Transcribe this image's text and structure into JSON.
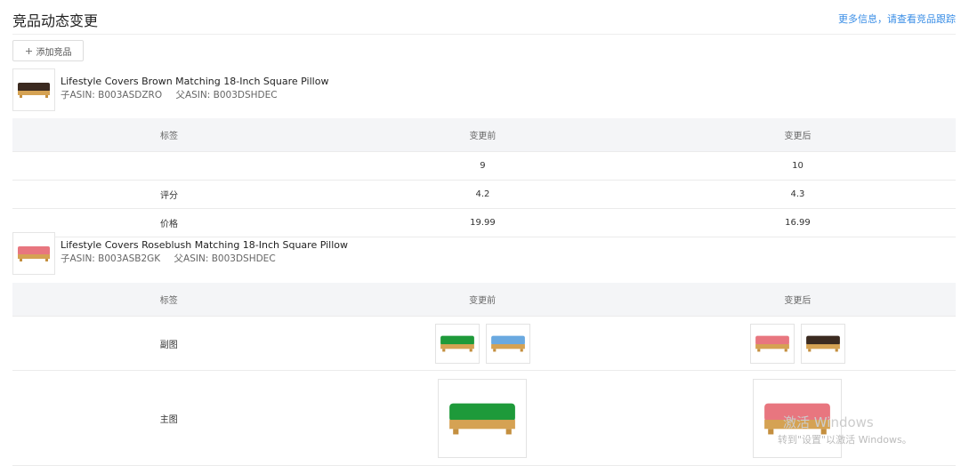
{
  "header": {
    "title": "竞品动态变更",
    "more_link": "更多信息，请查看竞品跟踪"
  },
  "add_button": {
    "icon": "plus-icon",
    "label": "添加竞品"
  },
  "products": [
    {
      "name": "Lifestyle Covers Brown Matching 18-Inch Square Pillow",
      "child_asin": "子ASIN: B003ASDZRO",
      "parent_asin": "父ASIN: B003DSHDEC",
      "thumb_color": "#3b2a20",
      "table": {
        "headers": [
          "标签",
          "变更前",
          "变更后"
        ],
        "rows": [
          {
            "label": "",
            "before": "9",
            "after": "10"
          },
          {
            "label": "评分",
            "before": "4.2",
            "after": "4.3"
          },
          {
            "label": "价格",
            "before": "19.99",
            "after": "16.99"
          }
        ]
      }
    },
    {
      "name": "Lifestyle Covers Roseblush Matching 18-Inch Square Pillow",
      "child_asin": "子ASIN: B003ASB2GK",
      "parent_asin": "父ASIN: B003DSHDEC",
      "thumb_color": "#e8767f",
      "table": {
        "headers": [
          "标签",
          "变更前",
          "变更后"
        ],
        "rows": [
          {
            "label": "副图",
            "before_images": [
              "#1e9a3a",
              "#6aa9e0"
            ],
            "after_images": [
              "#e8767f",
              "#3b2a20"
            ]
          },
          {
            "label": "主图",
            "before_image": "#1e9a3a",
            "after_image": "#e8767f"
          }
        ]
      }
    }
  ],
  "watermark": {
    "line1": "激活 Windows",
    "line2": "转到\"设置\"以激活 Windows。"
  }
}
